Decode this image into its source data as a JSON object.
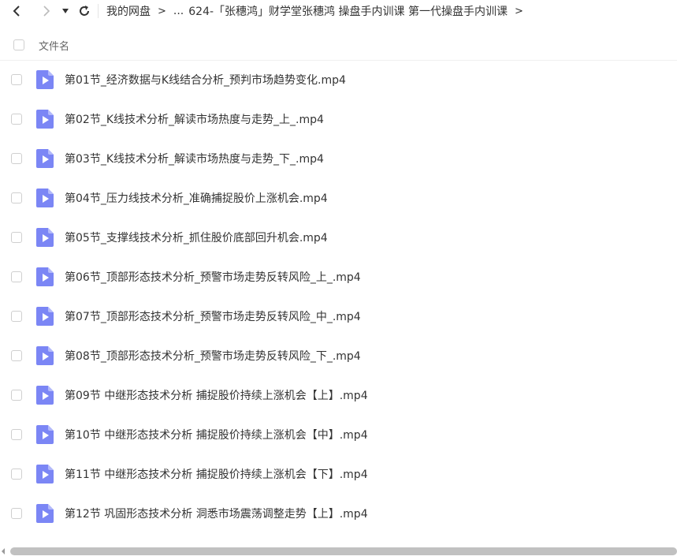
{
  "toolbar": {
    "back_icon": "chevron-left-icon",
    "forward_icon": "chevron-right-icon",
    "dropdown_icon": "caret-down-icon",
    "refresh_icon": "refresh-icon"
  },
  "breadcrumb": {
    "root": "我的网盘",
    "ellipsis": "...",
    "current": "624-「张穗鸿」财学堂张穗鸿 操盘手内训课 第一代操盘手内训课",
    "separator": ">"
  },
  "list_header": {
    "name_column": "文件名"
  },
  "files": [
    {
      "name": "第01节_经济数据与K线结合分析_预判市场趋势变化.mp4",
      "type": "video"
    },
    {
      "name": "第02节_K线技术分析_解读市场热度与走势_上_.mp4",
      "type": "video"
    },
    {
      "name": "第03节_K线技术分析_解读市场热度与走势_下_.mp4",
      "type": "video"
    },
    {
      "name": "第04节_压力线技术分析_准确捕捉股价上涨机会.mp4",
      "type": "video"
    },
    {
      "name": "第05节_支撑线技术分析_抓住股价底部回升机会.mp4",
      "type": "video"
    },
    {
      "name": "第06节_顶部形态技术分析_预警市场走势反转风险_上_.mp4",
      "type": "video"
    },
    {
      "name": "第07节_顶部形态技术分析_预警市场走势反转风险_中_.mp4",
      "type": "video"
    },
    {
      "name": "第08节_顶部形态技术分析_预警市场走势反转风险_下_.mp4",
      "type": "video"
    },
    {
      "name": "第09节 中继形态技术分析 捕捉股价持续上涨机会【上】.mp4",
      "type": "video"
    },
    {
      "name": "第10节 中继形态技术分析 捕捉股价持续上涨机会【中】.mp4",
      "type": "video"
    },
    {
      "name": "第11节 中继形态技术分析 捕捉股价持续上涨机会【下】.mp4",
      "type": "video"
    },
    {
      "name": "第12节 巩固形态技术分析 洞悉市场震荡调整走势【上】.mp4",
      "type": "video"
    }
  ],
  "colors": {
    "video_icon": "#7b86f5",
    "video_icon_fold": "#b3b9fa",
    "text": "#333333",
    "scroll_thumb": "#c1c1c1"
  }
}
